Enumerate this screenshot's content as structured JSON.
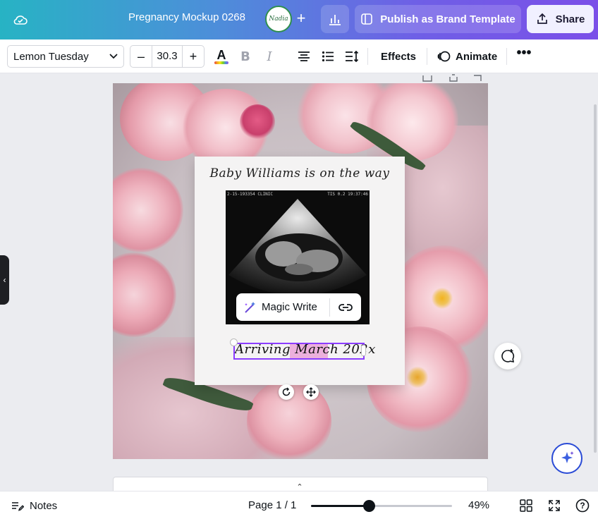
{
  "header": {
    "doc_title": "Pregnancy Mockup 0268",
    "avatar_text": "Nadia",
    "add_label": "+",
    "publish_label": "Publish as Brand Template",
    "share_label": "Share"
  },
  "toolbar": {
    "font_name": "Lemon Tuesday",
    "font_size": "30.3",
    "decrease_label": "–",
    "increase_label": "+",
    "bold_label": "B",
    "italic_label": "I",
    "text_color_label": "A",
    "effects_label": "Effects",
    "animate_label": "Animate",
    "more_label": "•••"
  },
  "design": {
    "title_text": "Baby Williams is on the way",
    "scan_header_left": "2-15-193354  CLINIC",
    "scan_header_right": "TIS 0.2  19:37:46",
    "selected_text": "Arriving March 202x"
  },
  "magic_write": {
    "label": "Magic Write"
  },
  "footer": {
    "notes_label": "Notes",
    "page_indicator": "Page 1 / 1",
    "zoom_level": "49%",
    "zoom_fraction": 0.41,
    "help_label": "?"
  },
  "colors": {
    "brand_purple": "#8b3dff",
    "header_start": "#27b3c4",
    "header_end": "#7b4fe8"
  }
}
